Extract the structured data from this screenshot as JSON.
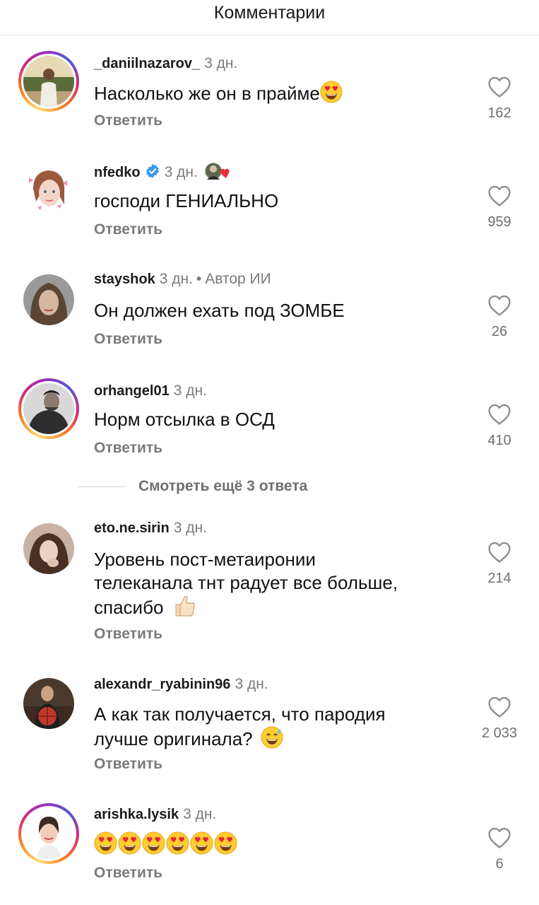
{
  "header": {
    "title": "Комментарии"
  },
  "comments": [
    {
      "username": "_daniilnazarov_",
      "time": "3 дн.",
      "text": "Насколько же он в прайме",
      "emoji": "heart-eyes",
      "reply": "Ответить",
      "likes": "162",
      "story_ring": true
    },
    {
      "username": "nfedko",
      "time": "3 дн.",
      "text": "господи ГЕНИАЛЬНО",
      "reply": "Ответить",
      "likes": "959",
      "verified": true,
      "liked_by_author": true
    },
    {
      "username": "stayshok",
      "time": "3 дн.",
      "author_tag": "Автор ИИ",
      "text": "Он должен ехать под ЗОМБЕ",
      "reply": "Ответить",
      "likes": "26"
    },
    {
      "username": "orhangel01",
      "time": "3 дн.",
      "text": "Норм отсылка в ОСД",
      "reply": "Ответить",
      "likes": "410",
      "story_ring": true
    },
    {
      "username": "eto.ne.sirin",
      "time": "3 дн.",
      "lines": [
        "Уровень пост-метаиронии",
        "телеканала тнт радует все больше,",
        "спасибо"
      ],
      "emoji": "thumbs-up",
      "reply": "Ответить",
      "likes": "214"
    },
    {
      "username": "alexandr_ryabinin96",
      "time": "3 дн.",
      "lines": [
        "А как так получается, что пародия",
        "лучше оригинала?"
      ],
      "emoji": "sweat-smile",
      "reply": "Ответить",
      "likes": "2 033"
    },
    {
      "username": "arishka.lysik",
      "time": "3 дн.",
      "emoji_row": 6,
      "reply": "Ответить",
      "likes": "6",
      "story_ring": true
    }
  ],
  "more_replies": "Смотреть ещё 3 ответа",
  "icons": {
    "like": "heart-outline-icon",
    "verified": "verified-badge-icon"
  },
  "colors": {
    "verified": "#3897f0",
    "liked_heart": "#ed2b3f",
    "secondary_text": "#7a7a7a"
  }
}
